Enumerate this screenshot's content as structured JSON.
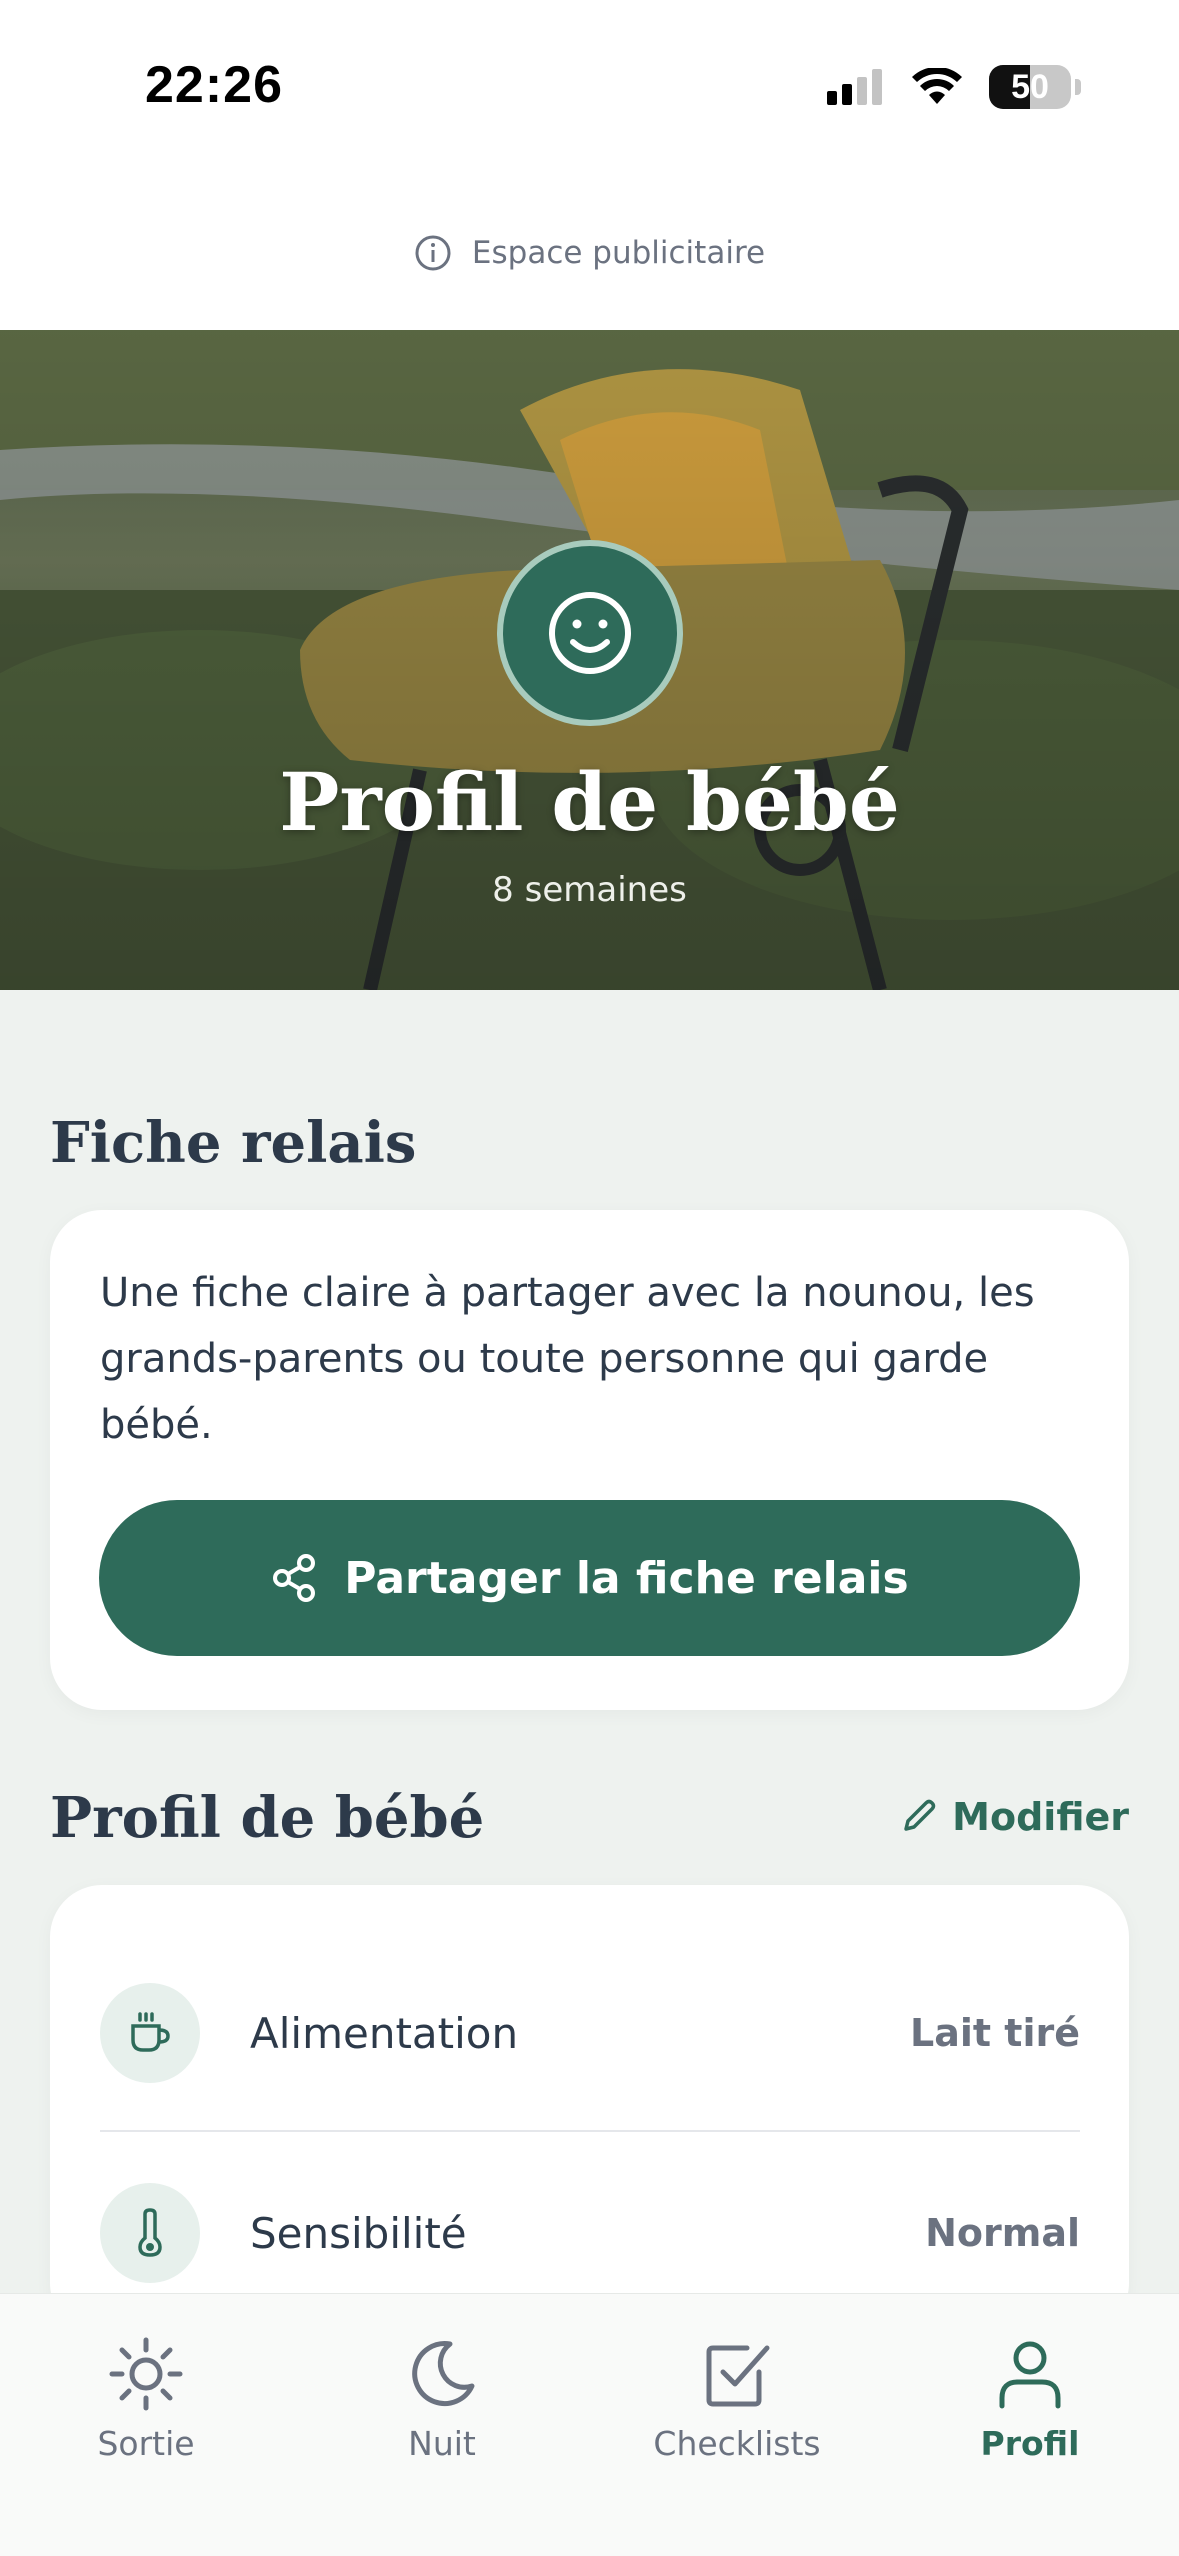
{
  "status_bar": {
    "time": "22:26",
    "battery": "50"
  },
  "ad": {
    "label": "Espace publicitaire"
  },
  "hero": {
    "title": "Profil de bébé",
    "subtitle": "8 semaines"
  },
  "relay_section": {
    "title": "Fiche relais",
    "description": "Une fiche claire à partager avec la nounou, les grands-parents ou toute personne qui garde bébé.",
    "share_label": "Partager la fiche relais"
  },
  "profile_section": {
    "title": "Profil de bébé",
    "edit_label": "Modifier",
    "rows": [
      {
        "label": "Alimentation",
        "value": "Lait tiré",
        "icon": "cup-icon"
      },
      {
        "label": "Sensibilité",
        "value": "Normal",
        "icon": "thermometer-icon"
      }
    ]
  },
  "tabs": [
    {
      "label": "Sortie",
      "icon": "sun-icon",
      "active": false
    },
    {
      "label": "Nuit",
      "icon": "moon-icon",
      "active": false
    },
    {
      "label": "Checklists",
      "icon": "checkbox-icon",
      "active": false
    },
    {
      "label": "Profil",
      "icon": "user-icon",
      "active": true
    }
  ],
  "colors": {
    "accent": "#2e6b5a",
    "text": "#2d3a4a",
    "muted": "#6b7280",
    "background": "#eef2ef"
  }
}
